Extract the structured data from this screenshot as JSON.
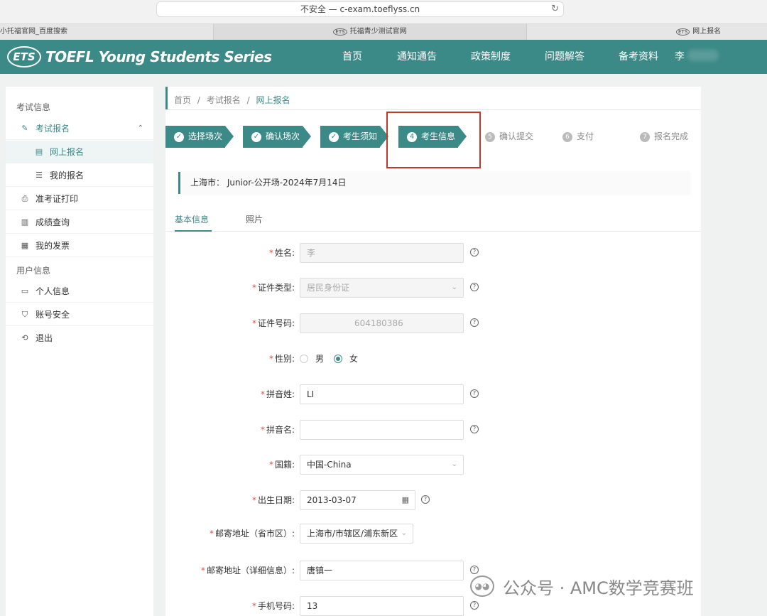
{
  "browser": {
    "address": "不安全 — c-exam.toeflyss.cn",
    "reload_glyph": "↻",
    "tabs": [
      {
        "label": "小托福官网_百度搜索"
      },
      {
        "label": "托福青少测试官网",
        "icon": "ETS"
      },
      {
        "label": "网上报名",
        "icon": "ETS"
      }
    ]
  },
  "header": {
    "logo_mark": "ETS",
    "logo_text": "TOEFL Young Students Series",
    "nav": [
      "首页",
      "通知通告",
      "政策制度",
      "问题解答",
      "备考资料"
    ],
    "user_initial": "李"
  },
  "sidebar": {
    "section_exam": "考试信息",
    "exam_register": "考试报名",
    "online_register": "网上报名",
    "my_register": "我的报名",
    "ticket_print": "准考证打印",
    "score_query": "成绩查询",
    "my_invoice": "我的发票",
    "section_user": "用户信息",
    "personal_info": "个人信息",
    "account_security": "账号安全",
    "logout": "退出",
    "icons": [
      "edit-icon",
      "form-icon",
      "list-icon",
      "printer-icon",
      "score-icon",
      "invoice-icon",
      "id-card-icon",
      "shield-icon",
      "logout-icon"
    ]
  },
  "breadcrumb": {
    "home": "首页",
    "sep1": "/",
    "exam": "考试报名",
    "sep2": "/",
    "current": "网上报名"
  },
  "steps": [
    {
      "label": "选择场次",
      "mark": "✓",
      "state": "done"
    },
    {
      "label": "确认场次",
      "mark": "✓",
      "state": "done"
    },
    {
      "label": "考生须知",
      "mark": "✓",
      "state": "done"
    },
    {
      "label": "考生信息",
      "mark": "4",
      "state": "current"
    },
    {
      "label": "确认提交",
      "mark": "5",
      "state": "pending"
    },
    {
      "label": "支付",
      "mark": "6",
      "state": "pending"
    },
    {
      "label": "报名完成",
      "mark": "7",
      "state": "pending"
    }
  ],
  "session_info": "上海市：  Junior-公开场-2024年7月14日",
  "form_tabs": [
    "基本信息",
    "照片"
  ],
  "form": {
    "name": {
      "label": "姓名:",
      "value": "李"
    },
    "id_type": {
      "label": "证件类型:",
      "value": "居民身份证"
    },
    "id_number": {
      "label": "证件号码:",
      "value": "604180386"
    },
    "gender": {
      "label": "性别:",
      "option_male": "男",
      "option_female": "女",
      "selected": "女"
    },
    "pinyin_surname": {
      "label": "拼音姓:",
      "value": "LI"
    },
    "pinyin_given": {
      "label": "拼音名:",
      "value": ""
    },
    "nationality": {
      "label": "国籍:",
      "value": "中国-China"
    },
    "birth_date": {
      "label": "出生日期:",
      "value": "2013-03-07"
    },
    "mail_region": {
      "label": "邮寄地址（省市区）:",
      "value": "上海市/市辖区/浦东新区"
    },
    "mail_detail": {
      "label": "邮寄地址（详细信息）:",
      "value": "唐镇一"
    },
    "phone": {
      "label": "手机号码:",
      "value": "13"
    },
    "required_mark": "*",
    "help_glyph": "?",
    "dropdown_glyph": "⌄",
    "calendar_glyph": "▦"
  },
  "watermark": {
    "text": "公众号 · AMC数学竞赛班"
  },
  "colors": {
    "primary": "#3b8a88",
    "highlight_box": "#c0392b",
    "required": "#d9534f"
  }
}
